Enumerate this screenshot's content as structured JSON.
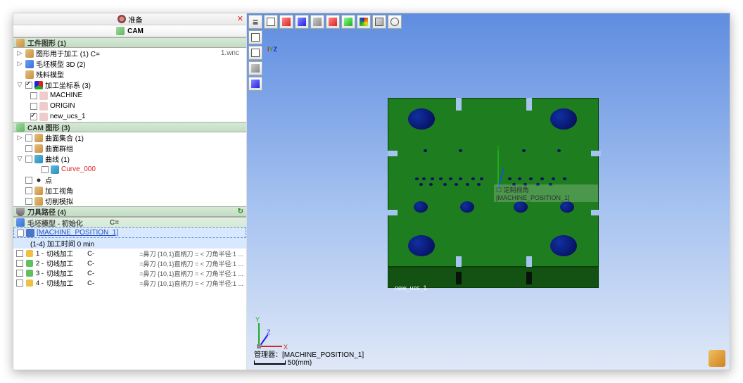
{
  "tabs": {
    "top": "准备",
    "active": "CAM"
  },
  "sections": {
    "part": "工件图形 (1)",
    "cam_geom": "CAM 图形 (3)",
    "toolpath": "刀具路径 (4)"
  },
  "tree": {
    "geom_used": "图形用于加工 (1) C=",
    "geom_file": "1.wnc",
    "stock3d": "毛坯模型 3D (2)",
    "fixture": "残料模型",
    "coords_group": "加工坐标系 (3)",
    "coord_machine": "MACHINE",
    "coord_origin": "ORIGIN",
    "coord_newucs": "new_ucs_1",
    "surf_set": "曲面集合 (1)",
    "surf_group": "曲面群组",
    "curve_set": "曲线 (1)",
    "curve_item": "Curve_000",
    "points": "点",
    "mach_angle": "加工视角",
    "cut_sim": "切削模拟"
  },
  "tp": {
    "header_col1": "毛坯模型 - 初始化",
    "header_col2": "C=",
    "machine_pos": "[MACHINE_POSITION_1]",
    "mp_sub": "(1-4) 加工时间 0 min",
    "rows": [
      {
        "num": "1",
        "name": "切线加工",
        "c": "C-",
        "desc": "=鼻刀 {10,1}直柄刀 = < 刀角半径:1 ..."
      },
      {
        "num": "2",
        "name": "切线加工",
        "c": "C-",
        "desc": "=鼻刀 {10,1}直柄刀 = < 刀角半径:1 ..."
      },
      {
        "num": "3",
        "name": "切线加工",
        "c": "C-",
        "desc": "=鼻刀 {10,1}直柄刀 = < 刀角半径:1 ..."
      },
      {
        "num": "4",
        "name": "切线加工",
        "c": "C-",
        "desc": "=鼻刀 {10,1}直柄刀 = < 刀角半径:1 ..."
      }
    ]
  },
  "viewport": {
    "ucs_label": "new_ucs_1",
    "overlay": "☐ 定制视角[MACHINE_POSITION_1]",
    "footer_mgr": "管理器：[MACHINE_POSITION_1]",
    "scale": "50(mm)",
    "axes": {
      "x": "X",
      "y": "Y",
      "z": "Z"
    }
  }
}
